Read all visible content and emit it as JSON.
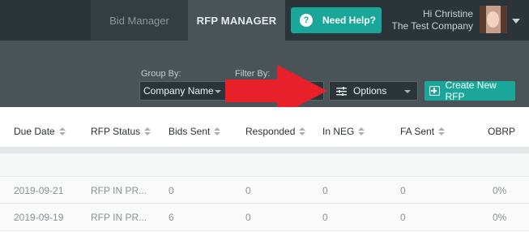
{
  "nav": {
    "tabs": [
      {
        "label": "Bid Manager",
        "active": false
      },
      {
        "label": "RFP MANAGER",
        "active": true
      }
    ],
    "help_label": "Need Help?",
    "help_icon": "question-icon",
    "user_greeting": "Hi Christine",
    "company": "The Test Company"
  },
  "toolbar": {
    "group_by_label": "Group By:",
    "group_by_value": "Company Name",
    "filter_by_label": "Filter By:",
    "filter_by_value": "",
    "options_label": "Options",
    "create_label": "Create New RFP"
  },
  "colors": {
    "accent": "#1aa79a",
    "nav_bg": "#2b3438",
    "toolbar_bg": "#4a5357",
    "annotation_arrow": "#e8202a"
  },
  "table": {
    "columns": [
      "Due Date",
      "RFP Status",
      "Bids Sent",
      "Responded",
      "In NEG",
      "FA Sent",
      "OBRP"
    ],
    "rows": [
      [
        "2019-09-21",
        "RFP IN PR...",
        "0",
        "0",
        "0",
        "0",
        "0%"
      ],
      [
        "2019-09-19",
        "RFP IN PR...",
        "6",
        "0",
        "0",
        "0",
        "0%"
      ]
    ]
  }
}
